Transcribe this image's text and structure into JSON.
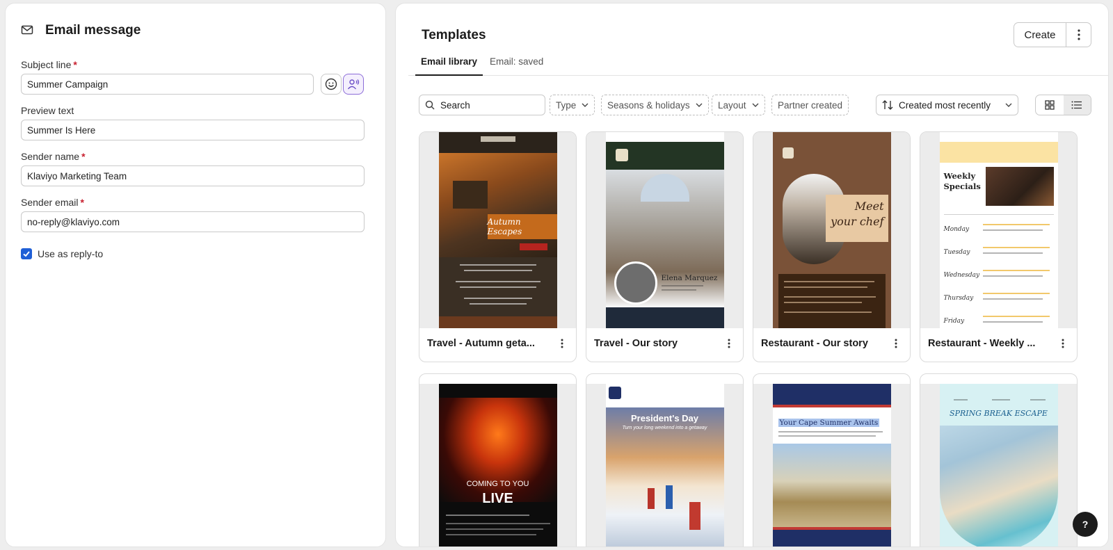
{
  "email_message": {
    "title": "Email message",
    "subject": {
      "label": "Subject line",
      "required": "*",
      "value": "Summer Campaign"
    },
    "preview": {
      "label": "Preview text",
      "value": "Summer Is Here"
    },
    "sender_name": {
      "label": "Sender name",
      "required": "*",
      "value": "Klaviyo Marketing Team"
    },
    "sender_email": {
      "label": "Sender email",
      "required": "*",
      "value": "no-reply@klaviyo.com"
    },
    "reply_to": {
      "label": "Use as reply-to",
      "checked": true
    }
  },
  "templates": {
    "title": "Templates",
    "create_label": "Create",
    "tabs": [
      {
        "label": "Email library",
        "active": true
      },
      {
        "label": "Email: saved",
        "active": false
      }
    ],
    "search_placeholder": "Search",
    "filters": {
      "type": "Type",
      "seasons": "Seasons & holidays",
      "layout": "Layout",
      "partner": "Partner created"
    },
    "sort_label": "Created most recently",
    "cards": [
      {
        "name": "Travel - Autumn geta..."
      },
      {
        "name": "Travel - Our story"
      },
      {
        "name": "Restaurant - Our story"
      },
      {
        "name": "Restaurant - Weekly ..."
      }
    ],
    "thumb_text": {
      "autumn_headline": "Autumn Escapes",
      "our_story_person": "Elena Marquez",
      "meet_chef": "Meet your chef",
      "weekly": "Weekly Specials",
      "days": [
        "Monday",
        "Tuesday",
        "Wednesday",
        "Thursday",
        "Friday"
      ],
      "coming": "COMING TO YOU",
      "live": "LIVE",
      "presidents": "President's Day",
      "presidents_sub": "Turn your long weekend into a getaway",
      "cape": "Your Cape Summer Awaits",
      "spring": "SPRING BREAK ESCAPE"
    },
    "help_label": "?"
  },
  "colors": {
    "accent_blue": "#1f5fd6",
    "required_red": "#c8202f",
    "ai_purple": "#8c6cd8"
  }
}
